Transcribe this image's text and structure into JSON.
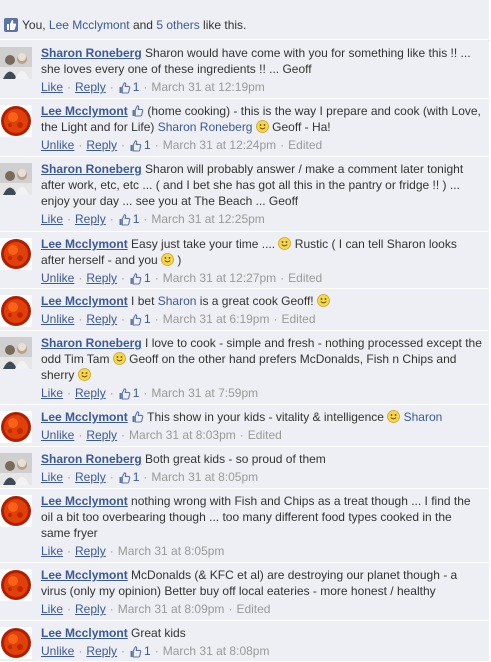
{
  "likes_bar": {
    "prefix": "You, ",
    "person": "Lee Mcclymont",
    "middle": " and ",
    "others": "5 others",
    "suffix": " like this."
  },
  "labels": {
    "like": "Like",
    "unlike": "Unlike",
    "reply": "Reply",
    "edited": "Edited",
    "sep": "·"
  },
  "comments": [
    {
      "author": "Sharon Roneberg",
      "avatar": "sharon-photo",
      "text": "Sharon would have come with you for something like this !! ... she loves every one of these ingredients !! ... Geoff",
      "action": "Like",
      "likes": "1",
      "time": "March 31 at 12:19pm",
      "edited": false
    },
    {
      "author": "Lee Mcclymont",
      "avatar": "sun-avatar",
      "text_a": "(home cooking) - this is the way I prepare and cook (with Love, the Light and for Life) ",
      "mention": "Sharon Roneberg",
      "text_b": " Geoff - Ha!",
      "action": "Unlike",
      "likes": "1",
      "time": "March 31 at 12:24pm",
      "edited": true
    },
    {
      "author": "Sharon Roneberg",
      "avatar": "sharon-photo",
      "text": "Sharon will probably answer / make a comment later tonight after work, etc, etc ... ( and I bet she has got all this in the pantry or fridge !! ) ... enjoy your day ... see you at The Beach ... Geoff",
      "action": "Like",
      "likes": "1",
      "time": "March 31 at 12:25pm",
      "edited": false
    },
    {
      "author": "Lee Mcclymont",
      "avatar": "sun-avatar",
      "text_a": "Easy just take your time .... ",
      "text_b": " Rustic ( I can tell Sharon looks after herself - and you ",
      "text_c": " )",
      "action": "Unlike",
      "likes": "1",
      "time": "March 31 at 12:27pm",
      "edited": true
    },
    {
      "author": "Lee Mcclymont",
      "avatar": "sun-avatar",
      "text_a": "I bet ",
      "mention": "Sharon",
      "text_b": " is a great cook Geoff! ",
      "action": "Unlike",
      "likes": "1",
      "time": "March 31 at 6:19pm",
      "edited": true
    },
    {
      "author": "Sharon Roneberg",
      "avatar": "sharon-photo",
      "text_a": "I love to cook - simple and fresh - nothing processed except the odd Tim Tam ",
      "text_b": " Geoff on the other hand prefers McDonalds, Fish n Chips and sherry ",
      "action": "Like",
      "likes": "1",
      "time": "March 31 at 7:59pm",
      "edited": false
    },
    {
      "author": "Lee Mcclymont",
      "avatar": "sun-avatar",
      "text_a": "This show in your kids - vitality & intelligence ",
      "mention": "Sharon",
      "action": "Unlike",
      "time": "March 31 at 8:03pm",
      "edited": true
    },
    {
      "author": "Sharon Roneberg",
      "avatar": "sharon-photo",
      "text": "Both great kids - so proud of them",
      "action": "Like",
      "likes": "1",
      "time": "March 31 at 8:05pm",
      "edited": false
    },
    {
      "author": "Lee Mcclymont",
      "avatar": "sun-avatar",
      "text": "nothing wrong with Fish and Chips as a treat though ... I find the oil a bit too overbearing though ... too many different food types cooked in the same fryer",
      "action": "Like",
      "time": "March 31 at 8:05pm",
      "edited": false
    },
    {
      "author": "Lee Mcclymont",
      "avatar": "sun-avatar",
      "text": "McDonalds (& KFC et al) are destroying our planet though - a virus (only my opinion) Better buy off local eateries - more honest / healthy",
      "action": "Like",
      "time": "March 31 at 8:09pm",
      "edited": true
    },
    {
      "author": "Lee Mcclymont",
      "avatar": "sun-avatar",
      "text": "Great kids",
      "action": "Unlike",
      "likes": "1",
      "time": "March 31 at 8:08pm",
      "edited": false
    }
  ]
}
